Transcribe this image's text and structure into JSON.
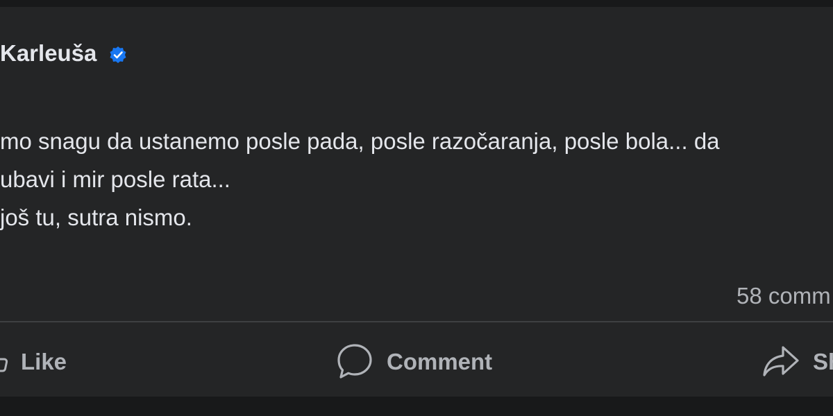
{
  "post": {
    "author": "Karleuša",
    "lines": [
      "mo snagu da ustanemo posle pada, posle razočaranja, posle bola... da",
      "ubavi i mir posle rata...",
      "još tu, sutra nismo."
    ],
    "comment_count": "58 comm"
  },
  "actions": {
    "like": "Like",
    "comment": "Comment",
    "share": "Sh"
  },
  "icons": {
    "verified": "verified-badge-icon",
    "like": "thumbs-up-icon",
    "comment": "speech-bubble-icon",
    "share": "share-arrow-icon"
  },
  "colors": {
    "background": "#18191a",
    "card": "#242526",
    "text": "#e4e6eb",
    "secondary_text": "#b0b3b8",
    "verified": "#1877f2"
  }
}
